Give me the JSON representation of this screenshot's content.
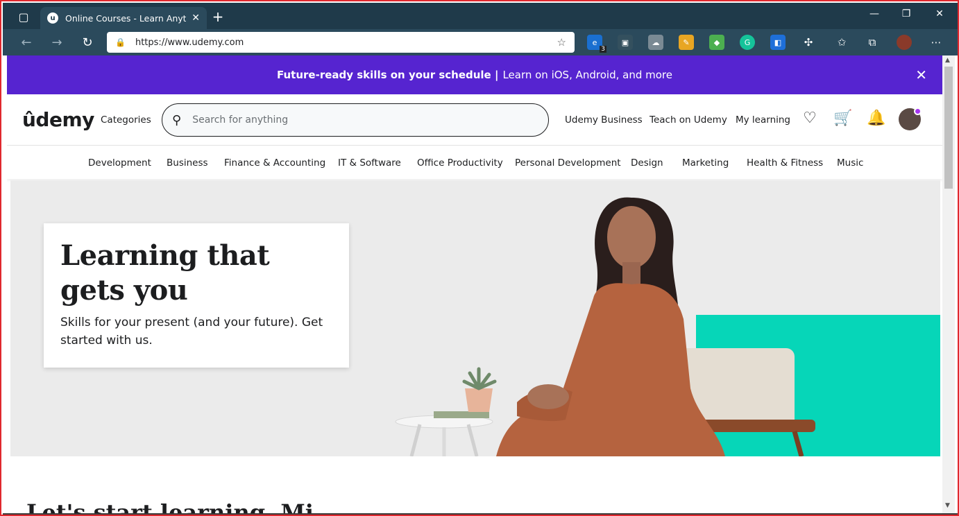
{
  "browser": {
    "tab_title": "Online Courses - Learn Anything",
    "url": "https://www.udemy.com",
    "extension_badge": "3"
  },
  "banner": {
    "bold_text": "Future-ready skills on your schedule |",
    "text": "Learn on iOS, Android, and more"
  },
  "header": {
    "logo": "ûdemy",
    "categories": "Categories",
    "search_placeholder": "Search for anything",
    "links": [
      "Udemy Business",
      "Teach on Udemy",
      "My learning"
    ]
  },
  "category_nav": [
    "Development",
    "Business",
    "Finance & Accounting",
    "IT & Software",
    "Office Productivity",
    "Personal Development",
    "Design",
    "Marketing",
    "Health & Fitness",
    "Music"
  ],
  "hero": {
    "title": "Learning that gets you",
    "subtitle": "Skills for your present (and your future). Get started with us."
  },
  "next_section_title": "Let's start learning, Mi",
  "colors": {
    "banner": "#5624d0",
    "accent": "#a435f0",
    "teal": "#06d6b8"
  }
}
